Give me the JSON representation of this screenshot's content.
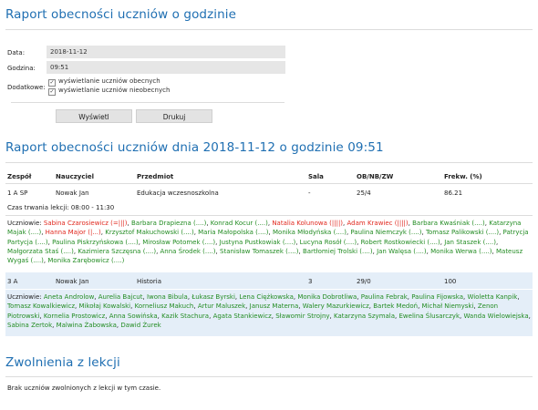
{
  "form": {
    "title": "Raport obecności uczniów o godzinie",
    "date_label": "Data:",
    "date_value": "2018-11-12",
    "hour_label": "Godzina:",
    "hour_value": "09:51",
    "extra_label": "Dodatkowe:",
    "opt_present": "wyświetlanie uczniów obecnych",
    "opt_absent": "wyświetlanie uczniów nieobecnych",
    "check_mark": "✓",
    "show_button": "Wyświetl",
    "print_button": "Drukuj"
  },
  "report": {
    "title": "Raport obecności uczniów dnia 2018-11-12 o godzinie 09:51",
    "columns": [
      "Zespół",
      "Nauczyciel",
      "Przedmiot",
      "Sala",
      "OB/NB/ZW",
      "Frekw. (%)"
    ],
    "groups": [
      {
        "team": "1 A SP",
        "teacher": "Nowak Jan",
        "subject": "Edukacja wczesnoszkolna",
        "room": "-",
        "counts": "25/4",
        "attendance": "86.21",
        "duration": "Czas trwania lekcji: 08:00 - 11:30",
        "students_label": "Uczniowie:",
        "students": [
          {
            "name": "Sabina Czarosiewicz (=|||)",
            "status": "absent"
          },
          {
            "name": "Barbara Drapiezna (....)",
            "status": "present"
          },
          {
            "name": "Konrad Kocur (....)",
            "status": "present"
          },
          {
            "name": "Natalia Kolunowa (||||)",
            "status": "absent"
          },
          {
            "name": "Adam Krawiec (||||)",
            "status": "absent"
          },
          {
            "name": "Barbara Kwaśniak (....)",
            "status": "present"
          },
          {
            "name": "Katarzyna Majak (....)",
            "status": "present"
          },
          {
            "name": "Hanna Major (|...)",
            "status": "absent"
          },
          {
            "name": "Krzysztof Makuchowski (....)",
            "status": "present"
          },
          {
            "name": "Maria Małopolska (....)",
            "status": "present"
          },
          {
            "name": "Monika Młodyńska (....)",
            "status": "present"
          },
          {
            "name": "Paulina Niemczyk (....)",
            "status": "present"
          },
          {
            "name": "Tomasz Palikowski (....)",
            "status": "present"
          },
          {
            "name": "Patrycja Partycja (....)",
            "status": "present"
          },
          {
            "name": "Paulina Piskrzyńskowa (....)",
            "status": "present"
          },
          {
            "name": "Mirosław Potomek (....)",
            "status": "present"
          },
          {
            "name": "Justyna Pustkowiak (....)",
            "status": "present"
          },
          {
            "name": "Lucyna Rosół (....)",
            "status": "present"
          },
          {
            "name": "Robert Rostkowiecki (....)",
            "status": "present"
          },
          {
            "name": "Jan Staszek (....)",
            "status": "present"
          },
          {
            "name": "Małgorzata Staś (....)",
            "status": "present"
          },
          {
            "name": "Kazimiera Szczęsna (....)",
            "status": "present"
          },
          {
            "name": "Anna Środek (....)",
            "status": "present"
          },
          {
            "name": "Stanisław Tomaszek (....)",
            "status": "present"
          },
          {
            "name": "Bartłomiej Trolski (....)",
            "status": "present"
          },
          {
            "name": "Jan Walęsa (....)",
            "status": "present"
          },
          {
            "name": "Monika Werwa (....)",
            "status": "present"
          },
          {
            "name": "Mateusz Wygaś (....)",
            "status": "present"
          },
          {
            "name": "Monika Zarębowicz (....)",
            "status": "present"
          }
        ]
      },
      {
        "team": "3 A",
        "teacher": "Nowak Jan",
        "subject": "Historia",
        "room": "3",
        "counts": "29/0",
        "attendance": "100",
        "students_label": "Uczniowie:",
        "students": [
          {
            "name": "Aneta Androlow",
            "status": "present"
          },
          {
            "name": "Aurelia Bajcut",
            "status": "present"
          },
          {
            "name": "Iwona Bibula",
            "status": "present"
          },
          {
            "name": "Łukasz Byrski",
            "status": "present"
          },
          {
            "name": "Lena Ciężkowska",
            "status": "present"
          },
          {
            "name": "Monika Dobrotliwa",
            "status": "present"
          },
          {
            "name": "Paulina Febrak",
            "status": "present"
          },
          {
            "name": "Paulina Fijowska",
            "status": "present"
          },
          {
            "name": "Wioletta Kanpik",
            "status": "present"
          },
          {
            "name": "Tomasz Kowalkiewicz",
            "status": "present"
          },
          {
            "name": "Mikołaj Kowalski",
            "status": "present"
          },
          {
            "name": "Korneliusz Makuch",
            "status": "present"
          },
          {
            "name": "Artur Maluszek",
            "status": "present"
          },
          {
            "name": "Janusz Materna",
            "status": "present"
          },
          {
            "name": "Walery Mazurkiewicz",
            "status": "present"
          },
          {
            "name": "Bartek Medoń",
            "status": "present"
          },
          {
            "name": "Michał Niemyski",
            "status": "present"
          },
          {
            "name": "Zenon Piotrowski",
            "status": "present"
          },
          {
            "name": "Kornelia Prostowicz",
            "status": "present"
          },
          {
            "name": "Anna Sowińska",
            "status": "present"
          },
          {
            "name": "Kazik Stachura",
            "status": "present"
          },
          {
            "name": "Agata Stankiewicz",
            "status": "present"
          },
          {
            "name": "Sławomir Strojny",
            "status": "present"
          },
          {
            "name": "Katarzyna Szymala",
            "status": "present"
          },
          {
            "name": "Ewelina Ślusarczyk",
            "status": "present"
          },
          {
            "name": "Wanda Wielowiejska",
            "status": "present"
          },
          {
            "name": "Sabina Zertok",
            "status": "present"
          },
          {
            "name": "Malwina Żabowska",
            "status": "present"
          },
          {
            "name": "Dawid Żurek",
            "status": "present"
          }
        ]
      }
    ]
  },
  "exemptions": {
    "title": "Zwolnienia z lekcji",
    "empty_text": "Brak uczniów zwolnionych z lekcji w tym czasie."
  },
  "colors": {
    "heading": "#1f6fb2",
    "present": "#238c23",
    "absent": "#e0281e",
    "row_highlight": "#e4eef8",
    "field_bg": "#e6e6e6"
  }
}
